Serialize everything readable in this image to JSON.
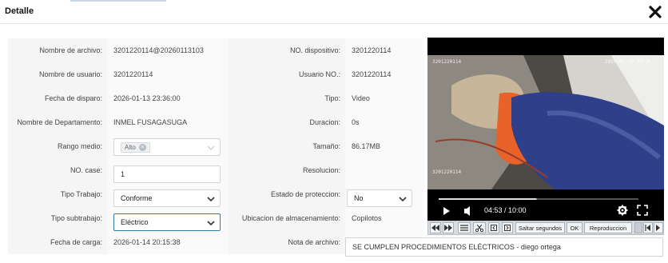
{
  "dialog": {
    "title": "Detalle"
  },
  "fields": {
    "nombre_archivo": {
      "label": "Nombre de archivo:",
      "value": "3201220114@20260113103"
    },
    "no_dispositivo": {
      "label": "NO. dispositivo:",
      "value": "3201220114"
    },
    "nombre_usuario": {
      "label": "Nombre de usuario:",
      "value": "3201220114"
    },
    "usuario_no": {
      "label": "Usuario NO.:",
      "value": "3201220114"
    },
    "fecha_disparo": {
      "label": "Fecha de disparo:",
      "value": "2026-01-13 23:36:00"
    },
    "tipo": {
      "label": "Tipo:",
      "value": "Video"
    },
    "departamento": {
      "label": "Nombre de Departamento:",
      "value": "INMEL FUSAGASUGA"
    },
    "duracion": {
      "label": "Duracion:",
      "value": "0s"
    },
    "rango_medio": {
      "label": "Rango medio:",
      "value": "Alto",
      "remove": "×"
    },
    "tamano": {
      "label": "Tamaño:",
      "value": "86.17MB"
    },
    "no_case": {
      "label": "NO. case:",
      "value": "1"
    },
    "resolucion": {
      "label": "Resolucion:",
      "value": ""
    },
    "tipo_trabajo": {
      "label": "Tipo Trabajo:",
      "value": "Conforme"
    },
    "estado_proteccion": {
      "label": "Estado de proteccion:",
      "value": "No"
    },
    "tipo_subtrabajo": {
      "label": "Tipo subtrabajo:",
      "value": "Eléctrico"
    },
    "ubicacion": {
      "label": "Ubicacion de almacenamiento:",
      "value": "Copilotos"
    },
    "fecha_carga": {
      "label": "Fecha de carga:",
      "value": "2026-01-14 20:15:38"
    },
    "nota_archivo": {
      "label": "Nota de archivo:",
      "value": "SE CUMPLEN PROCEDIMIENTOS ELÉCTRICOS - diego ortega"
    }
  },
  "player": {
    "time": "04:53 / 10:00",
    "progress": 0.49,
    "stamp_top_left": "3201220114",
    "stamp_top_right": "2026-01-13 23:36",
    "stamp_bottom": "3201220114",
    "controls": {
      "saltar": "Saltar segundos",
      "ok": "OK",
      "reproduccion": "Reproduccion"
    }
  },
  "colors": {
    "accent": "#2f7ea1",
    "glove": "#e8622a",
    "sleeve": "#2f3f8a"
  }
}
